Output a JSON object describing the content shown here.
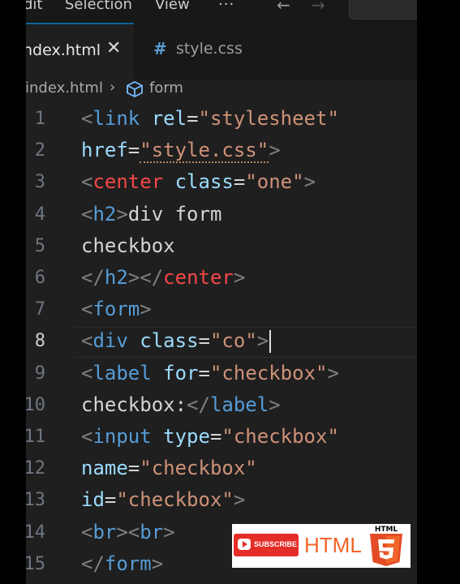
{
  "menu": {
    "items": [
      "dit",
      "Selection",
      "View"
    ],
    "more": "···",
    "back_icon": "arrow-left-icon",
    "forward_icon": "arrow-right-icon"
  },
  "tabs": [
    {
      "label": "ndex.html",
      "close": "✕",
      "active": true
    },
    {
      "label": "style.css",
      "icon_glyph": "#",
      "active": false
    }
  ],
  "breadcrumb": {
    "file": "index.html",
    "separator": "›",
    "symbol": "form",
    "symbol_icon": "cube-icon"
  },
  "editor": {
    "current_line": 8,
    "lines": [
      {
        "n": "1",
        "tokens": [
          [
            "punc",
            "<"
          ],
          [
            "tag",
            "link"
          ],
          [
            "text",
            " "
          ],
          [
            "attr",
            "rel"
          ],
          [
            "eq",
            "="
          ],
          [
            "str",
            "\"stylesheet\""
          ]
        ]
      },
      {
        "n": "2",
        "tokens": [
          [
            "attr",
            "href"
          ],
          [
            "eq",
            "="
          ],
          [
            "strsq",
            "\"style.css\""
          ],
          [
            "punc",
            ">"
          ]
        ]
      },
      {
        "n": "3",
        "tokens": [
          [
            "punc",
            "<"
          ],
          [
            "red",
            "center"
          ],
          [
            "text",
            " "
          ],
          [
            "attr",
            "class"
          ],
          [
            "eq",
            "="
          ],
          [
            "str",
            "\"one\""
          ],
          [
            "punc",
            ">"
          ]
        ]
      },
      {
        "n": "4",
        "tokens": [
          [
            "punc",
            "<"
          ],
          [
            "tag",
            "h2"
          ],
          [
            "punc",
            ">"
          ],
          [
            "text",
            "div form"
          ]
        ]
      },
      {
        "n": "5",
        "tokens": [
          [
            "text",
            "checkbox"
          ]
        ]
      },
      {
        "n": "6",
        "tokens": [
          [
            "punc",
            "</"
          ],
          [
            "tag",
            "h2"
          ],
          [
            "punc",
            "></"
          ],
          [
            "red",
            "center"
          ],
          [
            "punc",
            ">"
          ]
        ]
      },
      {
        "n": "7",
        "tokens": [
          [
            "punc",
            "<"
          ],
          [
            "tag",
            "form"
          ],
          [
            "punc",
            ">"
          ]
        ]
      },
      {
        "n": "8",
        "tokens": [
          [
            "punc",
            "<"
          ],
          [
            "tag",
            "div"
          ],
          [
            "text",
            " "
          ],
          [
            "attr",
            "class"
          ],
          [
            "eq",
            "="
          ],
          [
            "str",
            "\"co\""
          ],
          [
            "punc",
            ">"
          ],
          [
            "caret",
            ""
          ]
        ]
      },
      {
        "n": "9",
        "tokens": [
          [
            "punc",
            "<"
          ],
          [
            "tag",
            "label"
          ],
          [
            "text",
            " "
          ],
          [
            "attr",
            "for"
          ],
          [
            "eq",
            "="
          ],
          [
            "str",
            "\"checkbox\""
          ],
          [
            "punc",
            ">"
          ]
        ]
      },
      {
        "n": "10",
        "tokens": [
          [
            "text",
            "checkbox:"
          ],
          [
            "punc",
            "</"
          ],
          [
            "tag",
            "label"
          ],
          [
            "punc",
            ">"
          ]
        ]
      },
      {
        "n": "11",
        "tokens": [
          [
            "punc",
            "<"
          ],
          [
            "tag",
            "input"
          ],
          [
            "text",
            " "
          ],
          [
            "attr",
            "type"
          ],
          [
            "eq",
            "="
          ],
          [
            "str",
            "\"checkbox\""
          ]
        ]
      },
      {
        "n": "12",
        "tokens": [
          [
            "attr",
            "name"
          ],
          [
            "eq",
            "="
          ],
          [
            "str",
            "\"checkbox\""
          ]
        ]
      },
      {
        "n": "13",
        "tokens": [
          [
            "attr",
            "id"
          ],
          [
            "eq",
            "="
          ],
          [
            "str",
            "\"checkbox\""
          ],
          [
            "punc",
            ">"
          ]
        ]
      },
      {
        "n": "14",
        "tokens": [
          [
            "punc",
            "<"
          ],
          [
            "tag",
            "br"
          ],
          [
            "punc",
            "><"
          ],
          [
            "tag",
            "br"
          ],
          [
            "punc",
            ">"
          ]
        ]
      },
      {
        "n": "15",
        "tokens": [
          [
            "punc",
            "</"
          ],
          [
            "tag",
            "form"
          ],
          [
            "punc",
            ">"
          ]
        ]
      }
    ]
  },
  "overlay": {
    "subscribe": "SUBSCRIBE",
    "html_word": "HTML",
    "logo_text": "HTML",
    "logo_number": "5",
    "colors": {
      "youtube_red": "#e52d27",
      "html_orange": "#f06529",
      "html_orange_light": "#f16529"
    }
  },
  "colors": {
    "editor_bg": "#1f1f1f",
    "tag": "#569cd6",
    "attr": "#9cdcfe",
    "string": "#ce9178",
    "error_tag": "#f44747",
    "text": "#d4d4d4",
    "punctuation": "#808080",
    "line_number": "#6e7681"
  }
}
